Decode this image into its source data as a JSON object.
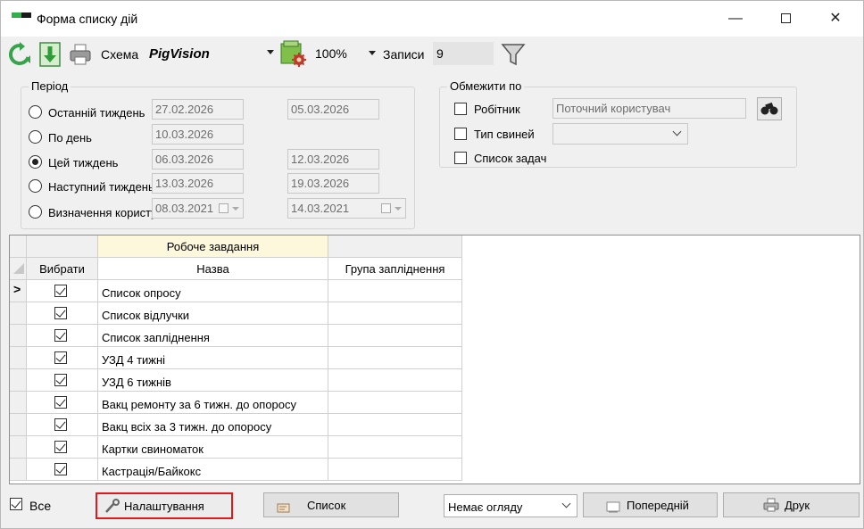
{
  "window": {
    "title": "Форма списку дій",
    "minimize_glyph": "—",
    "close_glyph": "✕"
  },
  "toolbar": {
    "scheme_label": "Схема",
    "scheme_value": "PigVision",
    "zoom_value": "100%",
    "records_label": "Записи",
    "records_value": "9",
    "icons": [
      "refresh-icon",
      "download-icon",
      "print-icon",
      "scheme-settings-icon",
      "filter-icon"
    ]
  },
  "period": {
    "title": "Період",
    "options": [
      {
        "label": "Останній тиждень",
        "from": "27.02.2026",
        "to": "05.03.2026",
        "checked": false
      },
      {
        "label": "По день",
        "from": "10.03.2026",
        "to": "",
        "checked": false
      },
      {
        "label": "Цей тиждень",
        "from": "06.03.2026",
        "to": "12.03.2026",
        "checked": true
      },
      {
        "label": "Наступний тиждень",
        "from": "13.03.2026",
        "to": "19.03.2026",
        "checked": false
      },
      {
        "label": "Визначення користувачем",
        "from": "08.03.2021",
        "to": "14.03.2021",
        "checked": false
      }
    ]
  },
  "limit": {
    "title": "Обмежити по",
    "worker_label": "Робітник",
    "worker_value": "Поточний користувач",
    "pig_type_label": "Тип свиней",
    "pig_type_value": "",
    "task_list_label": "Список задач"
  },
  "grid": {
    "band_header": "Робоче завдання",
    "col_select": "Вибрати",
    "col_name": "Назва",
    "col_group": "Група запліднення",
    "current_row_marker": ">",
    "rows": [
      {
        "name": "Список опросу",
        "checked": true,
        "group": ""
      },
      {
        "name": "Список відлучки",
        "checked": true,
        "group": ""
      },
      {
        "name": "Список запліднення",
        "checked": true,
        "group": ""
      },
      {
        "name": "УЗД 4 тижні",
        "checked": true,
        "group": ""
      },
      {
        "name": "УЗД 6 тижнів",
        "checked": true,
        "group": ""
      },
      {
        "name": "Вакц ремонту за 6 тижн. до опоросу",
        "checked": true,
        "group": ""
      },
      {
        "name": "Вакц всіх за 3 тижн. до опоросу",
        "checked": true,
        "group": ""
      },
      {
        "name": "Картки свиноматок",
        "checked": true,
        "group": ""
      },
      {
        "name": "Кастрація/Байкокс",
        "checked": true,
        "group": ""
      }
    ]
  },
  "bottom": {
    "all_label": "Все",
    "all_checked": true,
    "settings_label": "Налаштування",
    "list_label": "Список",
    "review_value": "Немає огляду",
    "prev_label": "Попередній",
    "print_label": "Друк"
  },
  "colors": {
    "accent_red": "#e0191f",
    "band_yellow": "#fdf7dc",
    "logo_green": "#2fb14a"
  }
}
